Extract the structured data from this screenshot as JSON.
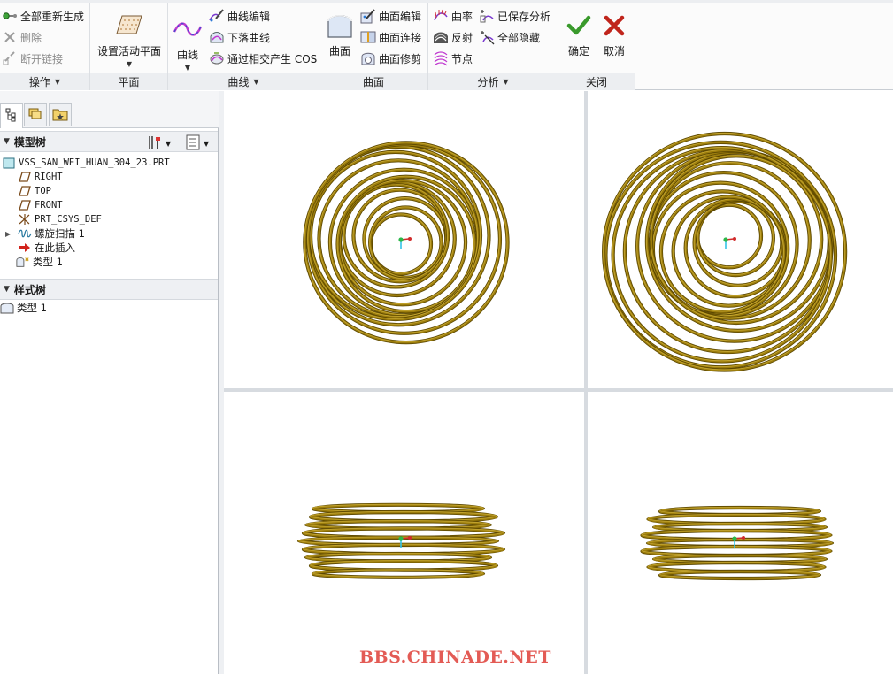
{
  "ribbon": {
    "groups": {
      "operations": {
        "footer": "操作",
        "regenerate": "全部重新生成",
        "delete": "删除",
        "break_link": "断开链接"
      },
      "plane": {
        "footer": "平面",
        "set_active_plane": "设置活动平面"
      },
      "curves": {
        "footer": "曲线",
        "curve": "曲线",
        "curve_edit": "曲线编辑",
        "drop_curve": "下落曲线",
        "cos_from_intersect": "通过相交产生 COS"
      },
      "surfaces": {
        "footer": "曲面",
        "surface": "曲面",
        "surface_edit": "曲面编辑",
        "surface_connect": "曲面连接",
        "surface_trim": "曲面修剪"
      },
      "analysis": {
        "footer": "分析",
        "curvature": "曲率",
        "reflection": "反射",
        "nodes": "节点",
        "saved_analysis": "已保存分析",
        "hide_all": "全部隐藏"
      },
      "close": {
        "footer": "关闭",
        "confirm": "确定",
        "cancel": "取消"
      }
    }
  },
  "model_tree": {
    "title": "模型树",
    "items": [
      {
        "label": "VSS_SAN_WEI_HUAN_304_23.PRT"
      },
      {
        "label": "RIGHT"
      },
      {
        "label": "TOP"
      },
      {
        "label": "FRONT"
      },
      {
        "label": "PRT_CSYS_DEF"
      },
      {
        "label": "螺旋扫描 1"
      },
      {
        "label": "在此插入"
      },
      {
        "label": "类型 1"
      }
    ]
  },
  "style_tree": {
    "title": "样式树",
    "items": [
      {
        "label": "类型 1"
      }
    ]
  },
  "watermark": "BBS.CHINADE.NET",
  "colors": {
    "coil": "#9c7d0c",
    "coil_dark": "#5b4700",
    "coil_light": "#d9bb46",
    "confirm": "#3a9a2c",
    "cancel": "#c0251c",
    "watermark": "#e35b55"
  },
  "icons": [
    "regenerate-icon",
    "delete-icon",
    "break-link-icon",
    "plane-icon",
    "curve-icon",
    "curve-edit-icon",
    "drop-curve-icon",
    "cos-icon",
    "surface-icon",
    "surface-edit-icon",
    "surface-connect-icon",
    "surface-trim-icon",
    "curvature-icon",
    "reflection-icon",
    "nodes-icon",
    "saved-analysis-icon",
    "hide-all-icon",
    "check-icon",
    "cross-icon"
  ]
}
